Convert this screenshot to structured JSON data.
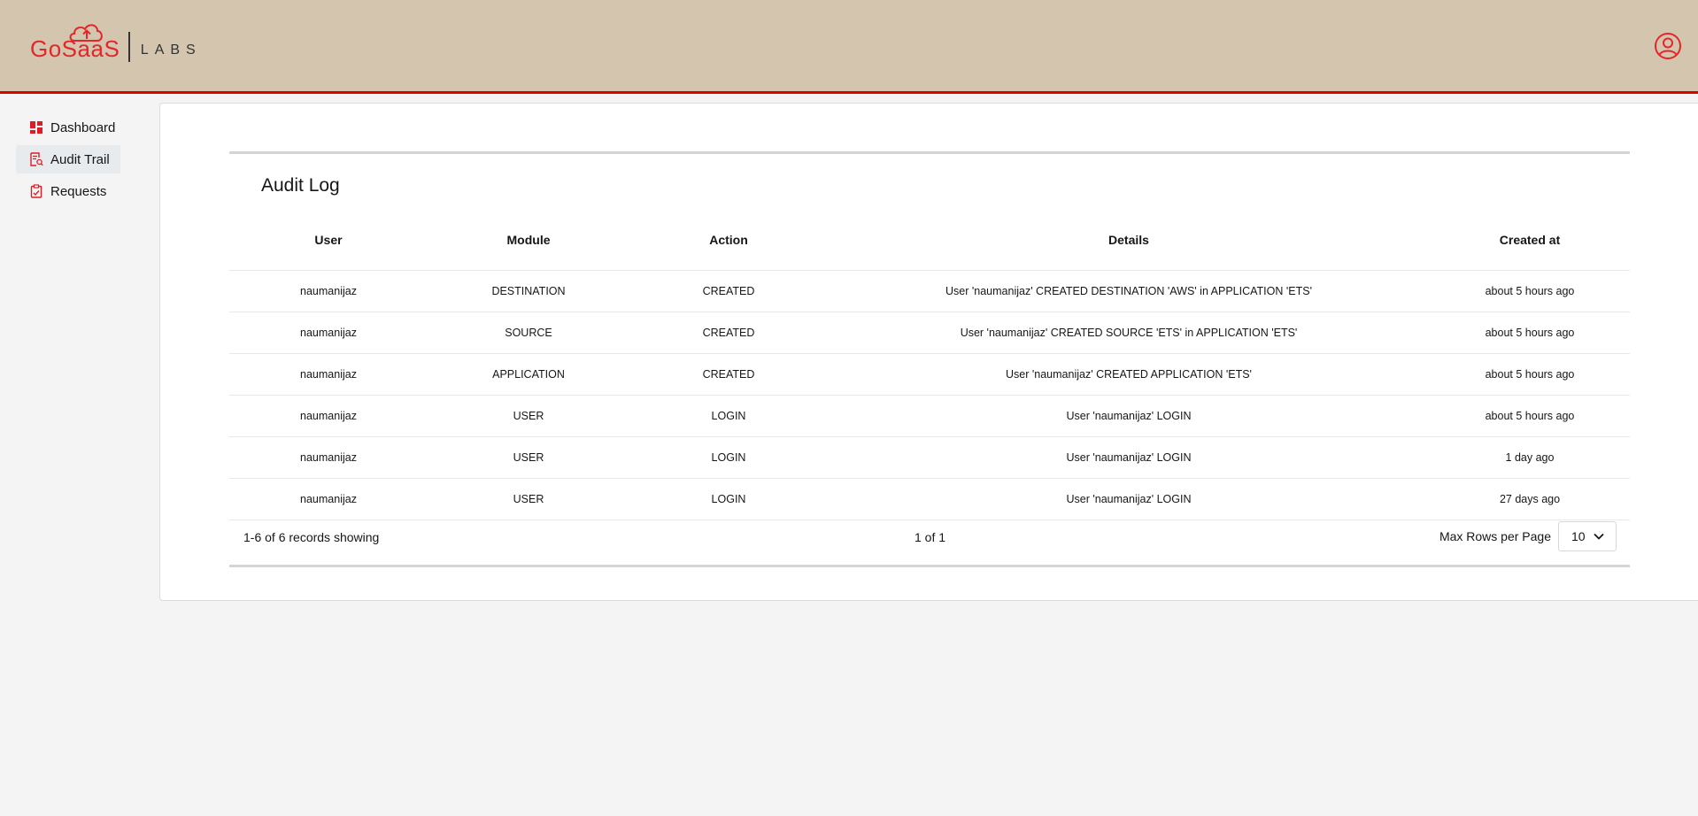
{
  "brand": {
    "logo_text": "GoSaaS",
    "labs_text": "LABS",
    "accent_color": "#e3262b",
    "header_bg": "#d4c6ae"
  },
  "header": {
    "account_icon": "user-circle-icon"
  },
  "sidebar": {
    "items": [
      {
        "label": "Dashboard",
        "icon": "dashboard-icon",
        "active": false
      },
      {
        "label": "Audit Trail",
        "icon": "audit-trail-icon",
        "active": true
      },
      {
        "label": "Requests",
        "icon": "requests-icon",
        "active": false
      }
    ]
  },
  "audit": {
    "title": "Audit Log",
    "columns": [
      "User",
      "Module",
      "Action",
      "Details",
      "Created at"
    ],
    "rows": [
      [
        "naumanijaz",
        "DESTINATION",
        "CREATED",
        "User 'naumanijaz' CREATED DESTINATION 'AWS' in APPLICATION 'ETS'",
        "about 5 hours ago"
      ],
      [
        "naumanijaz",
        "SOURCE",
        "CREATED",
        "User 'naumanijaz' CREATED SOURCE 'ETS' in APPLICATION 'ETS'",
        "about 5 hours ago"
      ],
      [
        "naumanijaz",
        "APPLICATION",
        "CREATED",
        "User 'naumanijaz' CREATED APPLICATION 'ETS'",
        "about 5 hours ago"
      ],
      [
        "naumanijaz",
        "USER",
        "LOGIN",
        "User 'naumanijaz' LOGIN",
        "about 5 hours ago"
      ],
      [
        "naumanijaz",
        "USER",
        "LOGIN",
        "User 'naumanijaz' LOGIN",
        "1 day ago"
      ],
      [
        "naumanijaz",
        "USER",
        "LOGIN",
        "User 'naumanijaz' LOGIN",
        "27 days ago"
      ]
    ],
    "footer": {
      "records_text": "1-6 of 6 records showing",
      "page_text": "1 of 1",
      "max_rows_label": "Max Rows per Page",
      "max_rows_value": "10"
    }
  }
}
